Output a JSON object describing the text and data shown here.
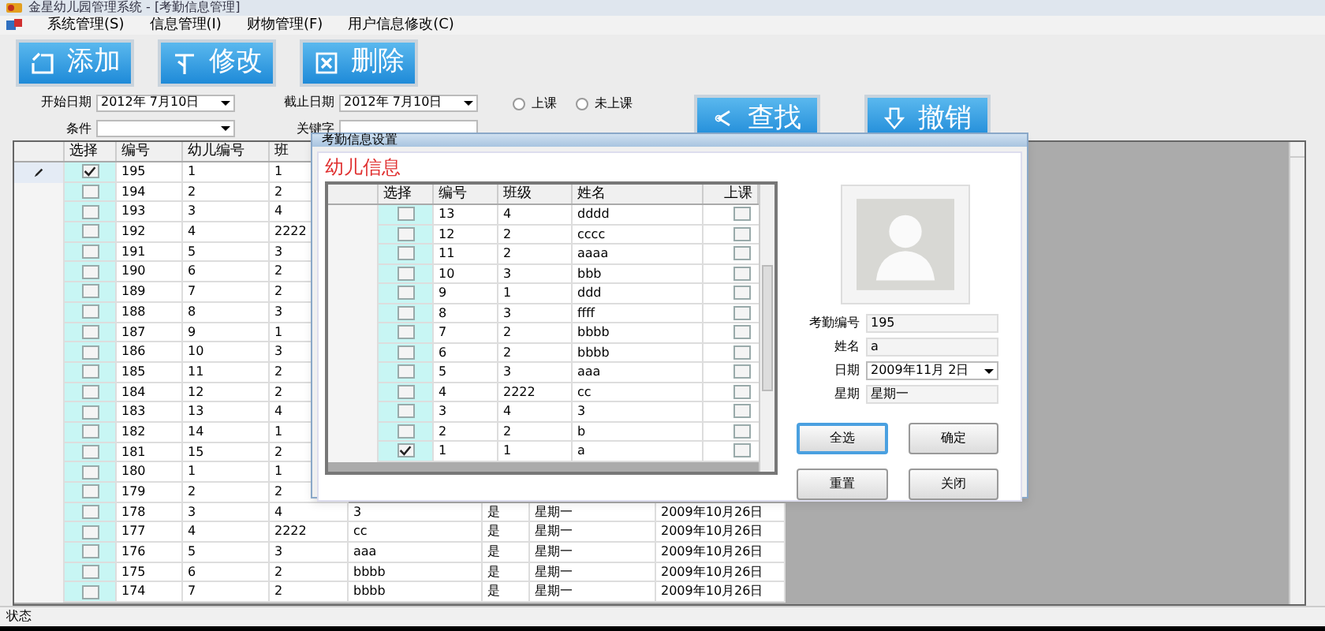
{
  "window": {
    "title": "金星幼儿园管理系统 - [考勤信息管理]"
  },
  "menu": [
    "系统管理(S)",
    "信息管理(I)",
    "财物管理(F)",
    "用户信息修改(C)"
  ],
  "toolbar": [
    {
      "kind": "add",
      "label": "添加"
    },
    {
      "kind": "edit",
      "label": "修改"
    },
    {
      "kind": "delete",
      "label": "删除"
    }
  ],
  "filters": {
    "start_date": {
      "label": "开始日期",
      "value": "2012年 7月10日"
    },
    "end_date": {
      "label": "截止日期",
      "value": "2012年 7月10日"
    },
    "condition": {
      "label": "条件"
    },
    "keyword": {
      "label": "关键字"
    },
    "radios": [
      {
        "label": "上课",
        "selected": false
      },
      {
        "label": "未上课",
        "selected": false
      }
    ],
    "search_button": "查找",
    "cancel_button": "撤销"
  },
  "grid": {
    "columns": [
      "选择",
      "编号",
      "幼儿编号",
      "班"
    ],
    "rows": [
      {
        "current": true,
        "checked": true,
        "id": "195",
        "child_no": "1",
        "class": "1"
      },
      {
        "current": false,
        "checked": false,
        "id": "194",
        "child_no": "2",
        "class": "2"
      },
      {
        "current": false,
        "checked": false,
        "id": "193",
        "child_no": "3",
        "class": "4"
      },
      {
        "current": false,
        "checked": false,
        "id": "192",
        "child_no": "4",
        "class": "2222"
      },
      {
        "current": false,
        "checked": false,
        "id": "191",
        "child_no": "5",
        "class": "3"
      },
      {
        "current": false,
        "checked": false,
        "id": "190",
        "child_no": "6",
        "class": "2"
      },
      {
        "current": false,
        "checked": false,
        "id": "189",
        "child_no": "7",
        "class": "2"
      },
      {
        "current": false,
        "checked": false,
        "id": "188",
        "child_no": "8",
        "class": "3"
      },
      {
        "current": false,
        "checked": false,
        "id": "187",
        "child_no": "9",
        "class": "1"
      },
      {
        "current": false,
        "checked": false,
        "id": "186",
        "child_no": "10",
        "class": "3"
      },
      {
        "current": false,
        "checked": false,
        "id": "185",
        "child_no": "11",
        "class": "2"
      },
      {
        "current": false,
        "checked": false,
        "id": "184",
        "child_no": "12",
        "class": "2"
      },
      {
        "current": false,
        "checked": false,
        "id": "183",
        "child_no": "13",
        "class": "4"
      },
      {
        "current": false,
        "checked": false,
        "id": "182",
        "child_no": "14",
        "class": "1"
      },
      {
        "current": false,
        "checked": false,
        "id": "181",
        "child_no": "15",
        "class": "2"
      },
      {
        "current": false,
        "checked": false,
        "id": "180",
        "child_no": "1",
        "class": "1"
      },
      {
        "current": false,
        "checked": false,
        "id": "179",
        "child_no": "2",
        "class": "2"
      },
      {
        "current": false,
        "checked": false,
        "id": "178",
        "child_no": "3",
        "class": "4",
        "name": "3",
        "attended": "是",
        "weekday": "星期一",
        "date": "2009年10月26日"
      },
      {
        "current": false,
        "checked": false,
        "id": "177",
        "child_no": "4",
        "class": "2222",
        "name": "cc",
        "attended": "是",
        "weekday": "星期一",
        "date": "2009年10月26日"
      },
      {
        "current": false,
        "checked": false,
        "id": "176",
        "child_no": "5",
        "class": "3",
        "name": "aaa",
        "attended": "是",
        "weekday": "星期一",
        "date": "2009年10月26日"
      },
      {
        "current": false,
        "checked": false,
        "id": "175",
        "child_no": "6",
        "class": "2",
        "name": "bbbb",
        "attended": "是",
        "weekday": "星期一",
        "date": "2009年10月26日"
      },
      {
        "current": false,
        "checked": false,
        "id": "174",
        "child_no": "7",
        "class": "2",
        "name": "bbbb",
        "attended": "是",
        "weekday": "星期一",
        "date": "2009年10月26日"
      }
    ]
  },
  "dialog": {
    "title": "考勤信息设置",
    "section_title": "幼儿信息",
    "columns": [
      "选择",
      "编号",
      "班级",
      "姓名",
      "上课"
    ],
    "rows": [
      {
        "checked": false,
        "no": "13",
        "class": "4",
        "name": "dddd",
        "attended": false
      },
      {
        "checked": false,
        "no": "12",
        "class": "2",
        "name": "cccc",
        "attended": false
      },
      {
        "checked": false,
        "no": "11",
        "class": "2",
        "name": "aaaa",
        "attended": false
      },
      {
        "checked": false,
        "no": "10",
        "class": "3",
        "name": "bbb",
        "attended": false
      },
      {
        "checked": false,
        "no": "9",
        "class": "1",
        "name": "ddd",
        "attended": false
      },
      {
        "checked": false,
        "no": "8",
        "class": "3",
        "name": "ffff",
        "attended": false
      },
      {
        "checked": false,
        "no": "7",
        "class": "2",
        "name": "bbbb",
        "attended": false
      },
      {
        "checked": false,
        "no": "6",
        "class": "2",
        "name": "bbbb",
        "attended": false
      },
      {
        "checked": false,
        "no": "5",
        "class": "3",
        "name": "aaa",
        "attended": false
      },
      {
        "checked": false,
        "no": "4",
        "class": "2222",
        "name": "cc",
        "attended": false
      },
      {
        "checked": false,
        "no": "3",
        "class": "4",
        "name": "3",
        "attended": false
      },
      {
        "checked": false,
        "no": "2",
        "class": "2",
        "name": "b",
        "attended": false
      },
      {
        "checked": true,
        "no": "1",
        "class": "1",
        "name": "a",
        "attended": false
      }
    ],
    "fields": [
      {
        "kind": "text",
        "label": "考勤编号",
        "value": "195"
      },
      {
        "kind": "text",
        "label": "姓名",
        "value": "a"
      },
      {
        "kind": "date",
        "label": "日期",
        "value": "2009年11月 2日"
      },
      {
        "kind": "text",
        "label": "星期",
        "value": "星期一"
      }
    ],
    "buttons": [
      {
        "label": "全选",
        "focused": true
      },
      {
        "label": "确定",
        "focused": false
      },
      {
        "label": "重置",
        "focused": false
      },
      {
        "label": "关闭",
        "focused": false
      }
    ]
  },
  "status_bar": "状态"
}
